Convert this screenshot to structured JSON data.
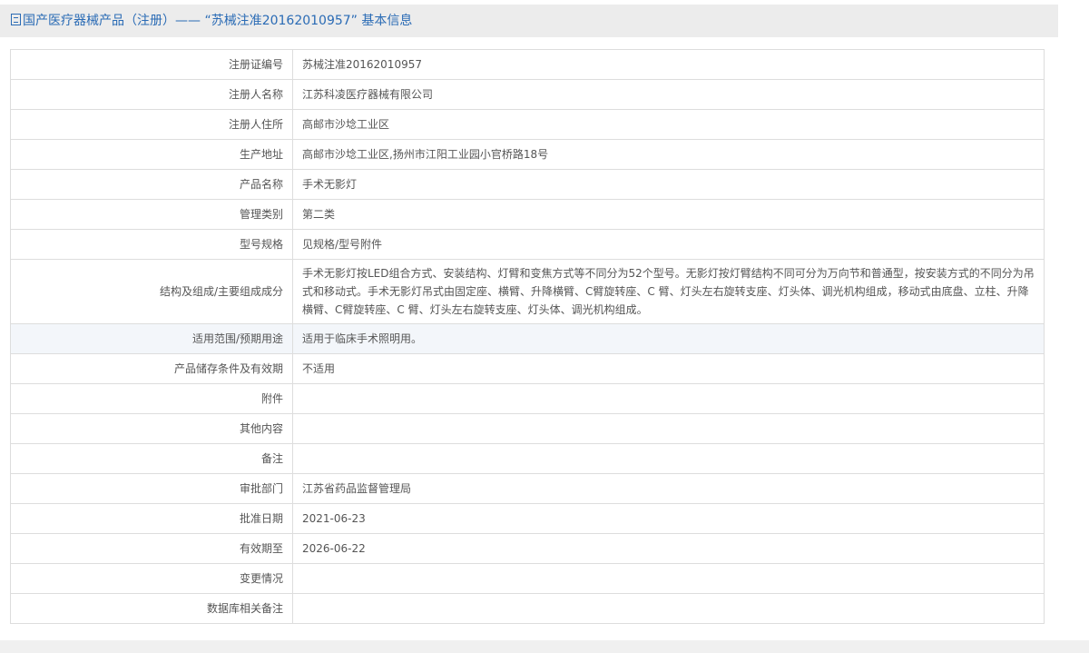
{
  "header": {
    "title": "国产医疗器械产品（注册）—— “苏械注准20162010957” 基本信息"
  },
  "rows": [
    {
      "label": "注册证编号",
      "value": "苏械注准20162010957"
    },
    {
      "label": "注册人名称",
      "value": "江苏科凌医疗器械有限公司"
    },
    {
      "label": "注册人住所",
      "value": "高邮市沙埝工业区"
    },
    {
      "label": "生产地址",
      "value": "高邮市沙埝工业区,扬州市江阳工业园小官桥路18号"
    },
    {
      "label": "产品名称",
      "value": "手术无影灯"
    },
    {
      "label": "管理类别",
      "value": "第二类"
    },
    {
      "label": "型号规格",
      "value": "见规格/型号附件"
    },
    {
      "label": "结构及组成/主要组成成分",
      "value": "手术无影灯按LED组合方式、安装结构、灯臂和变焦方式等不同分为52个型号。无影灯按灯臂结构不同可分为万向节和普通型，按安装方式的不同分为吊式和移动式。手术无影灯吊式由固定座、横臂、升降横臂、C臂旋转座、C 臂、灯头左右旋转支座、灯头体、调光机构组成，移动式由底盘、立柱、升降横臂、C臂旋转座、C 臂、灯头左右旋转支座、灯头体、调光机构组成。"
    },
    {
      "label": "适用范围/预期用途",
      "value": "适用于临床手术照明用。"
    },
    {
      "label": "产品储存条件及有效期",
      "value": "不适用"
    },
    {
      "label": "附件",
      "value": ""
    },
    {
      "label": "其他内容",
      "value": ""
    },
    {
      "label": "备注",
      "value": ""
    },
    {
      "label": "审批部门",
      "value": "江苏省药品监督管理局"
    },
    {
      "label": "批准日期",
      "value": "2021-06-23"
    },
    {
      "label": "有效期至",
      "value": "2026-06-22"
    },
    {
      "label": "变更情况",
      "value": ""
    },
    {
      "label": "数据库相关备注",
      "value": ""
    }
  ]
}
